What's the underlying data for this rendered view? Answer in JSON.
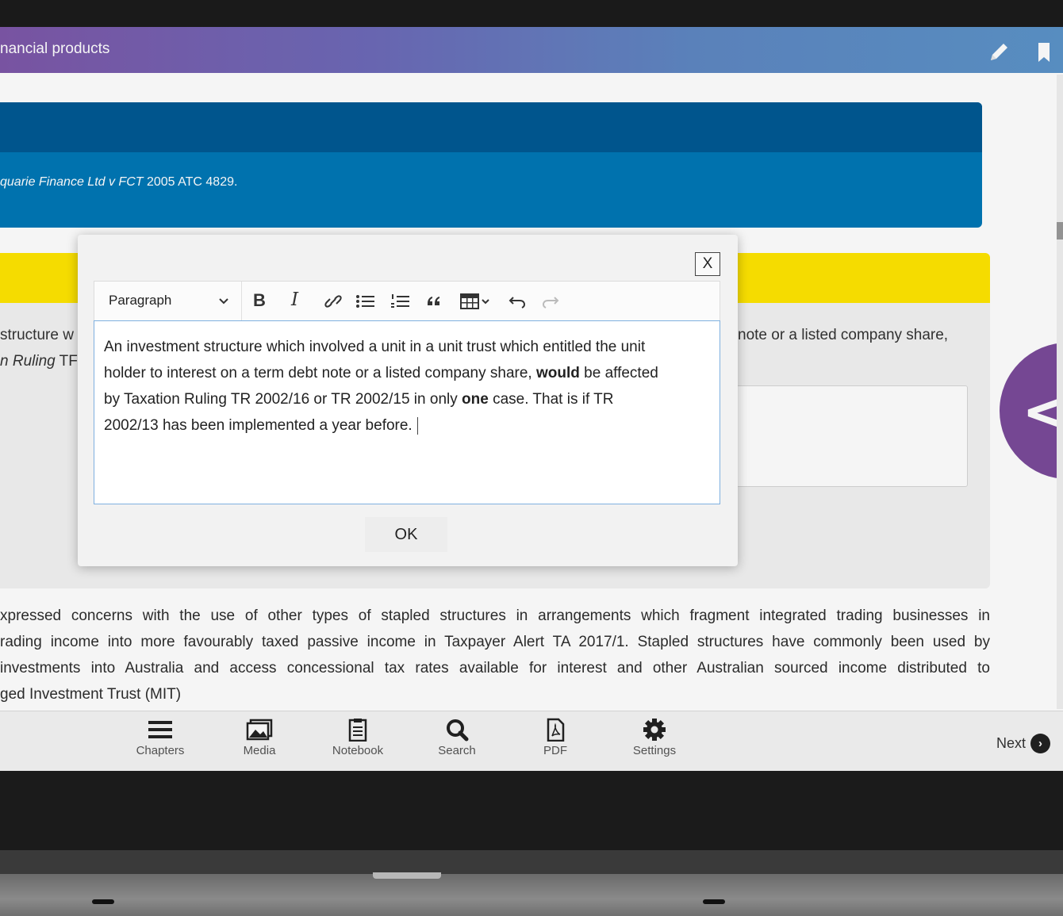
{
  "header": {
    "title": "nancial products"
  },
  "banner": {
    "case_italic": "quarie Finance Ltd v FCT",
    "case_rest": " 2005 ATC 4829."
  },
  "background": {
    "line1_left": "structure w",
    "line1_right": "note or a listed company share,",
    "line2_italic": "n Ruling",
    "line2_rest": " TF"
  },
  "side_button": {
    "glyph": "</"
  },
  "paragraph": {
    "lines": [
      "xpressed concerns with the use of other types of stapled structures in arrangements which fragment integrated trading businesses in",
      "rading income into more favourably taxed passive income in Taxpayer Alert TA 2017/1. Stapled structures have commonly been used by",
      "investments into Australia and access concessional tax rates available for interest and other Australian sourced income distributed to",
      "ged Investment Trust (MIT)"
    ]
  },
  "bottom_nav": {
    "chapters": "Chapters",
    "media": "Media",
    "notebook": "Notebook",
    "search": "Search",
    "pdf": "PDF",
    "settings": "Settings",
    "next": "Next"
  },
  "modal": {
    "close_label": "X",
    "format_select": "Paragraph",
    "toolbar": {
      "bold": "B",
      "italic": "I"
    },
    "editor": {
      "line1": "An investment structure which involved a unit in a unit trust which entitled the unit",
      "line2_a": "holder to interest on a term debt note or a listed company share, ",
      "line2_bold": "would",
      "line2_b": " be affected",
      "line3_a": "by Taxation Ruling TR 2002/16 or TR 2002/15 in only ",
      "line3_bold": "one",
      "line3_b": " case. That is if TR",
      "line4": "2002/13 has been implemented a year before."
    },
    "ok_label": "OK"
  }
}
